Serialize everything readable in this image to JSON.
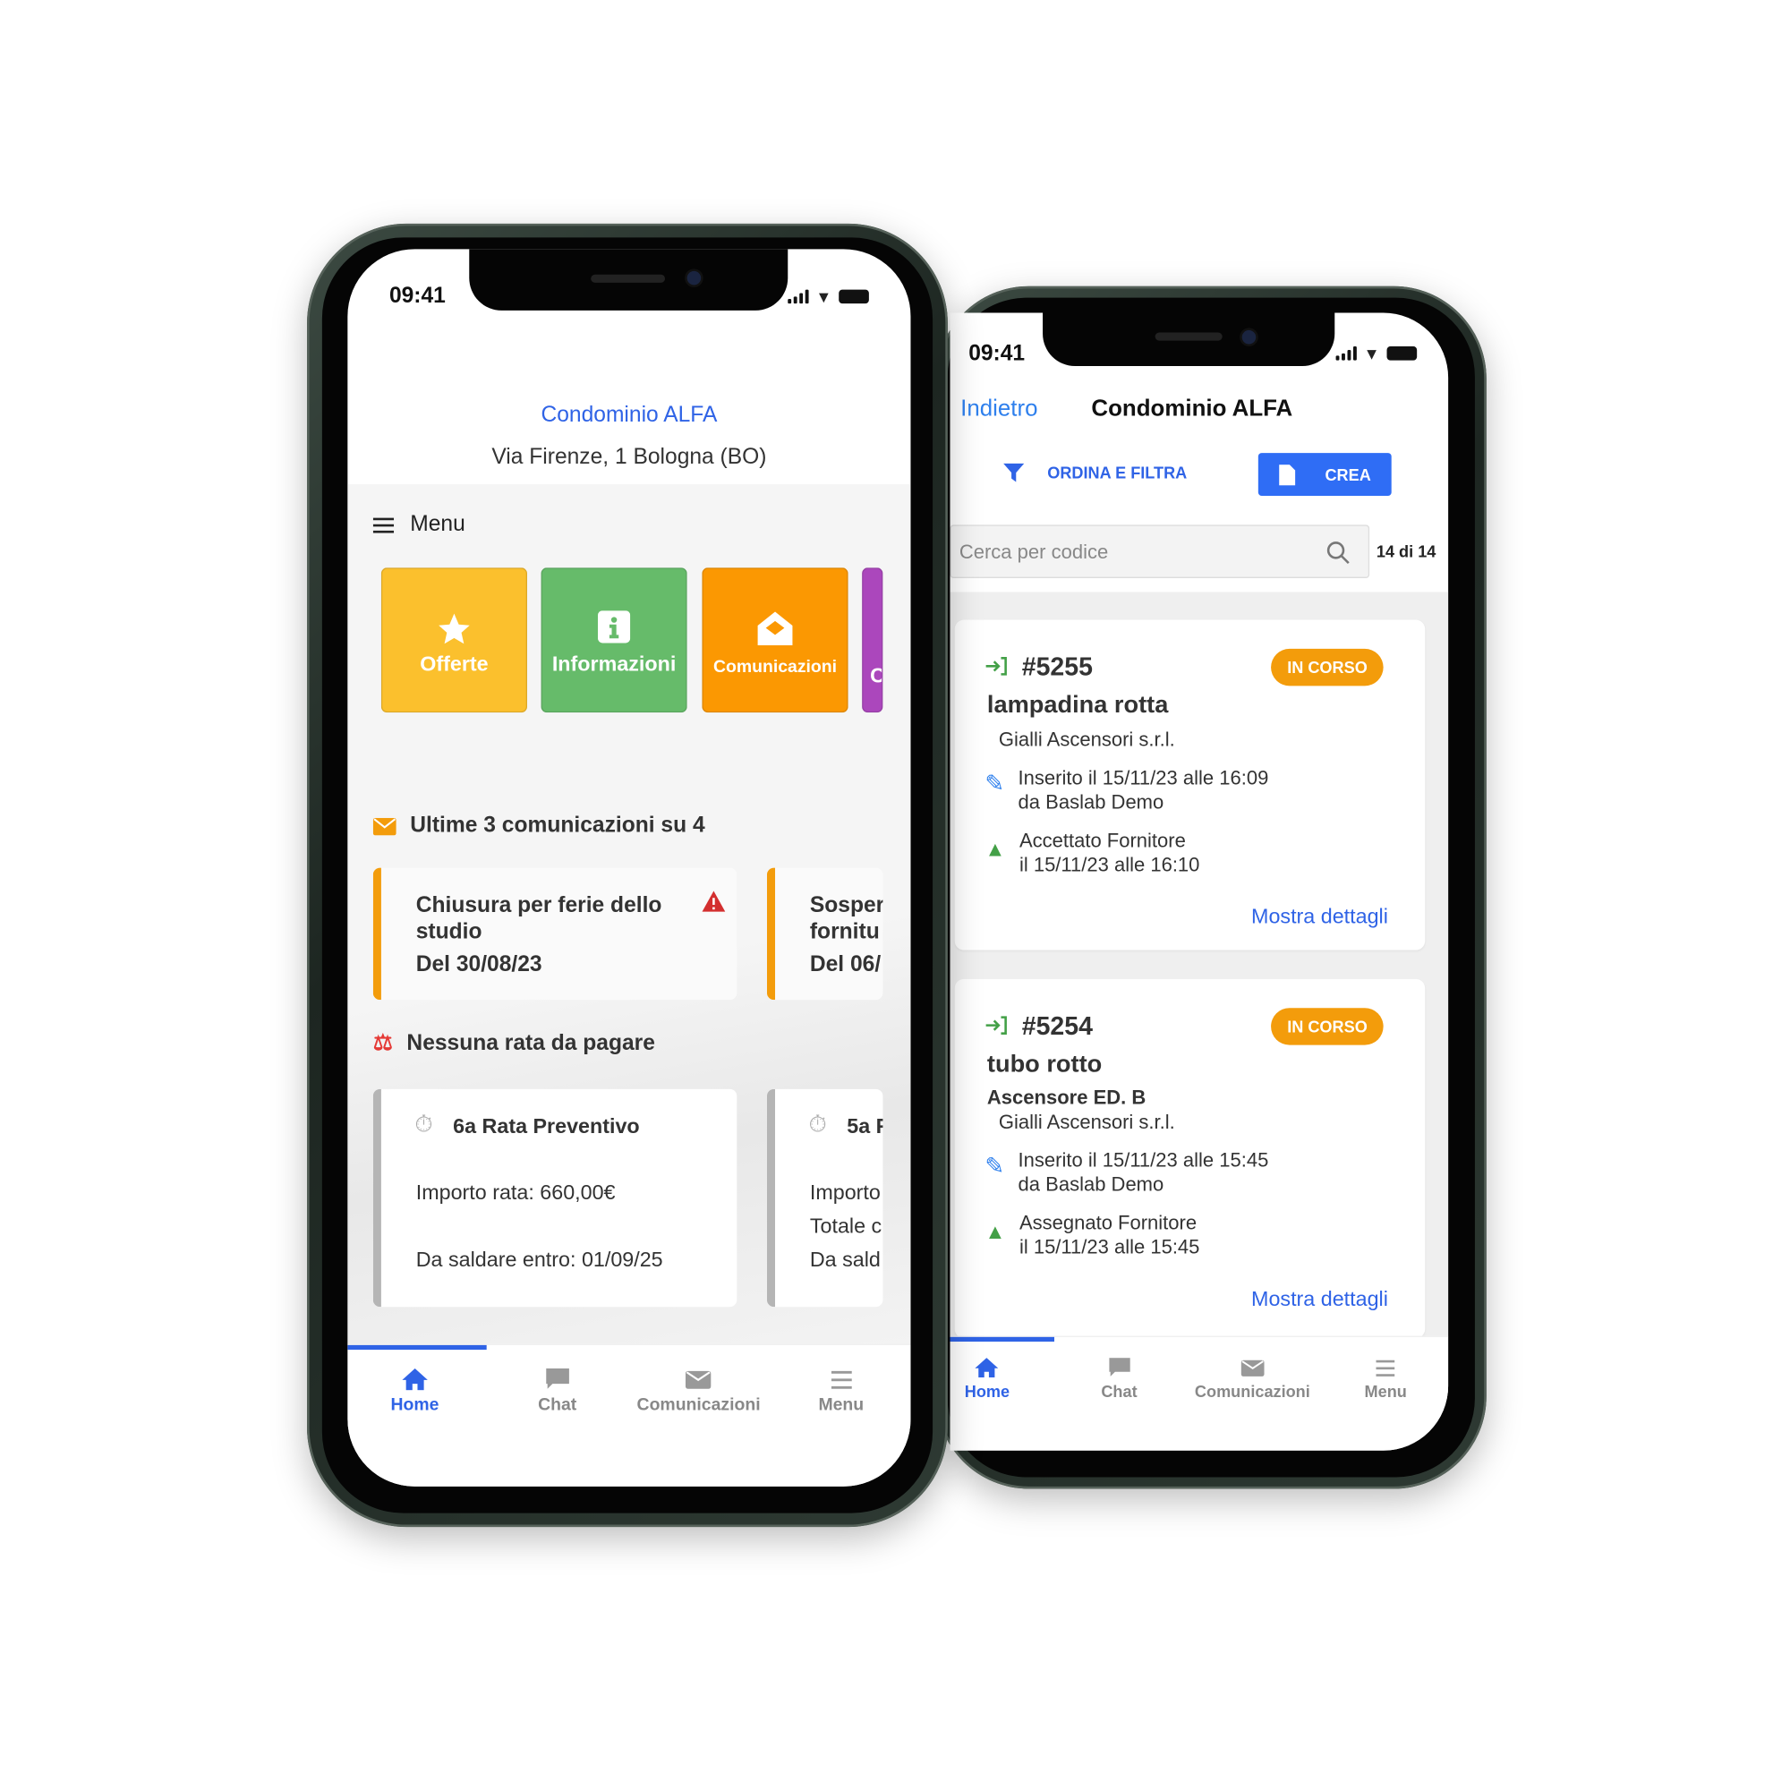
{
  "colors": {
    "accent": "#2f63e6",
    "offerte": "#fbc02d",
    "informazioni": "#66bb6a",
    "comunicazioni": "#fb9802",
    "purple": "#ab47bc",
    "status_in_corso": "#f39c0b",
    "alert": "#d32f2f"
  },
  "left_phone": {
    "status_time": "09:41",
    "header": {
      "title": "Condominio ALFA",
      "address": "Via Firenze, 1 Bologna (BO)"
    },
    "menu_label": "Menu",
    "tiles": [
      {
        "label": "Offerte",
        "icon": "star-icon"
      },
      {
        "label": "Informazioni",
        "icon": "info-icon"
      },
      {
        "label": "Comunicazioni",
        "icon": "envelope-open-icon"
      },
      {
        "label": "C",
        "icon": "unknown-icon"
      }
    ],
    "communications": {
      "title": "Ultime 3 comunicazioni su 4",
      "items": [
        {
          "title": "Chiusura per ferie dello studio",
          "date": "Del 30/08/23",
          "alert": true
        },
        {
          "title": "Sosper fornitu",
          "date": "Del 06/"
        }
      ]
    },
    "payments": {
      "title": "Nessuna rata da pagare",
      "items": [
        {
          "title": "6a Rata Preventivo",
          "lines": [
            "Importo rata: 660,00€",
            "Da saldare entro: 01/09/25"
          ]
        },
        {
          "title": "5a R",
          "lines": [
            "Importo",
            "Totale c",
            "Da sald"
          ]
        }
      ]
    },
    "tabs": [
      {
        "label": "Home",
        "icon": "home-icon",
        "active": true
      },
      {
        "label": "Chat",
        "icon": "chat-icon"
      },
      {
        "label": "Comunicazioni",
        "icon": "envelope-icon"
      },
      {
        "label": "Menu",
        "icon": "hamburger-icon"
      }
    ]
  },
  "right_phone": {
    "status_time": "09:41",
    "nav": {
      "back": "Indietro",
      "title": "Condominio ALFA"
    },
    "toolbar": {
      "filter_label": "ORDINA E FILTRA",
      "create_label": "CREA"
    },
    "search": {
      "placeholder": "Cerca per codice",
      "count": "14 di 14"
    },
    "tickets": [
      {
        "code": "#5255",
        "status": "IN CORSO",
        "title": "lampadina rotta",
        "location": "",
        "supplier": "Gialli Ascensori s.r.l.",
        "inserted": [
          "Inserito il 15/11/23 alle 16:09",
          "da Baslab Demo"
        ],
        "assigned": [
          "Accettato Fornitore",
          "il 15/11/23 alle 16:10"
        ],
        "details": "Mostra dettagli"
      },
      {
        "code": "#5254",
        "status": "IN CORSO",
        "title": "tubo rotto",
        "location": "Ascensore ED. B",
        "supplier": "Gialli Ascensori s.r.l.",
        "inserted": [
          "Inserito il 15/11/23 alle 15:45",
          "da Baslab Demo"
        ],
        "assigned": [
          "Assegnato Fornitore",
          "il 15/11/23 alle 15:45"
        ],
        "details": "Mostra dettagli"
      }
    ],
    "tabs": [
      {
        "label": "Home",
        "icon": "home-icon",
        "active": true
      },
      {
        "label": "Chat",
        "icon": "chat-icon"
      },
      {
        "label": "Comunicazioni",
        "icon": "envelope-icon"
      },
      {
        "label": "Menu",
        "icon": "hamburger-icon"
      }
    ]
  }
}
